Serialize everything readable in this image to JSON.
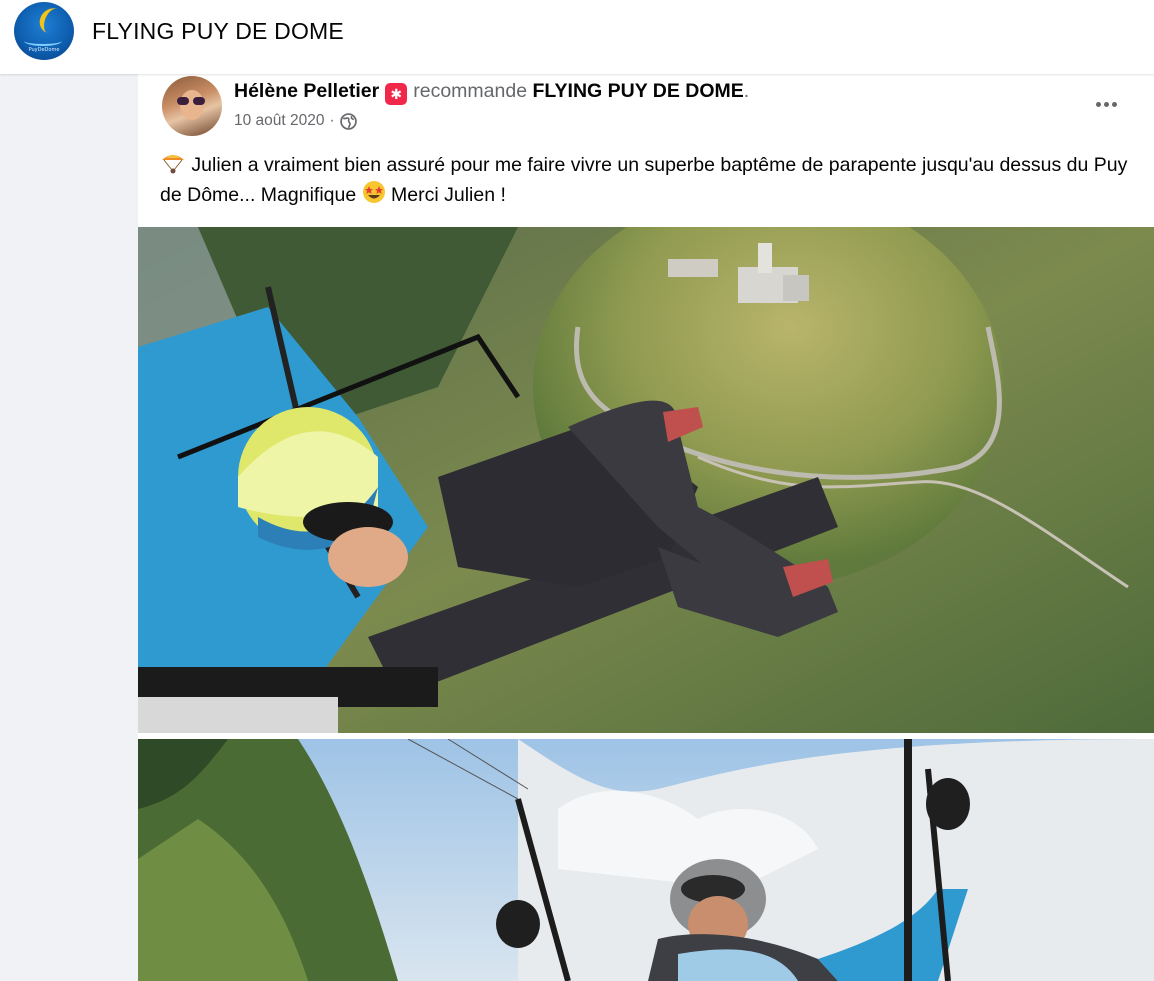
{
  "header": {
    "page_name": "FLYING PUY DE DOME",
    "logo_icon": "paraglider-logo-icon"
  },
  "post": {
    "author": "Hélène Pelletier",
    "recommend_badge_icon": "recommend-badge-icon",
    "verb": "recommande",
    "page": "FLYING PUY DE DOME",
    "period": ".",
    "date": "10 août 2020",
    "separator": "·",
    "audience_icon": "globe-icon",
    "more_icon": "more-options-icon",
    "text_before_emoji": " Julien a vraiment bien assuré pour me faire vivre un superbe baptême de parapente jusqu'au dessus du Puy de Dôme... Magnifique ",
    "text_after_emoji": " Merci Julien !",
    "lead_emoji_icon": "parachute-emoji-icon",
    "star_eyes_emoji_icon": "star-struck-emoji-icon"
  },
  "colors": {
    "page_bg": "#f0f2f5",
    "text_primary": "#050505",
    "text_secondary": "#65676b",
    "badge": "#f02849"
  }
}
